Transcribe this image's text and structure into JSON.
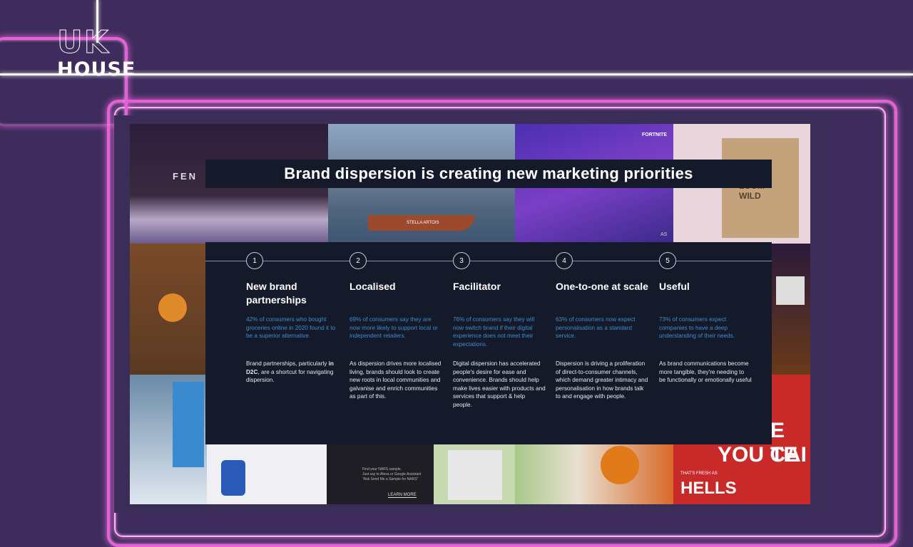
{
  "logo": {
    "line1": "UK",
    "line2": "HOUSE"
  },
  "slide": {
    "title": "Brand dispersion is creating new marketing priorities",
    "collage_text": {
      "fendi": "FEN",
      "boat": "STELLA ARTOIS",
      "fortnite": "FORTNITE",
      "box": "LOOM WILD",
      "you_can_1": "E TE",
      "you_can_2": "YOU CAI",
      "fresh": "THAT'S FRESH AS",
      "hells": "HELLS",
      "nars_1": "Find your NARS sample.",
      "nars_2": "Just say to Alexa or Google Assistant",
      "nars_3": "\"Ask Send Me a Sample for NARS\"",
      "nars_learn": "LEARN MORE",
      "as_label": "AS"
    },
    "columns": [
      {
        "number": "1",
        "title": "New brand partnerships",
        "stat": "42% of consumers who bought groceries online in 2020 found it to be a superior alternative.",
        "desc_before": "Brand partnerships, particularly ",
        "desc_bold": "in D2C",
        "desc_after": ", are a shortcut for navigating dispersion."
      },
      {
        "number": "2",
        "title": "Localised",
        "stat": "69% of consumers say they are now more likely to support local or independent retailers.",
        "desc": "As dispersion drives more localised living, brands should look to create new roots in local communities and galvanise and enrich communities as part of this."
      },
      {
        "number": "3",
        "title": "Facilitator",
        "stat": "76% of consumers say they will now switch brand if their digital experience does not meet their expectations.",
        "desc": "Digital dispersion has accelerated people's desire for ease and convenience. Brands should help make lives easier with products and services that support & help people."
      },
      {
        "number": "4",
        "title": "One-to-one at scale",
        "stat": "63% of consumers now expect personalisation as a standard service.",
        "desc": "Dispersion is driving a proliferation of direct-to-consumer channels, which demand greater intimacy and personalisation in how brands talk to and engage with people."
      },
      {
        "number": "5",
        "title": "Useful",
        "stat": "73% of consumers expect companies to have a deep understanding of their needs.",
        "desc": "As brand communications become more tangible, they're needing to be functionally or emotionally useful"
      }
    ]
  },
  "colors": {
    "background": "#3d2c5c",
    "neon_pink": "#e463d4",
    "panel": "#151a2b",
    "stat_blue": "#3f8cc8"
  }
}
